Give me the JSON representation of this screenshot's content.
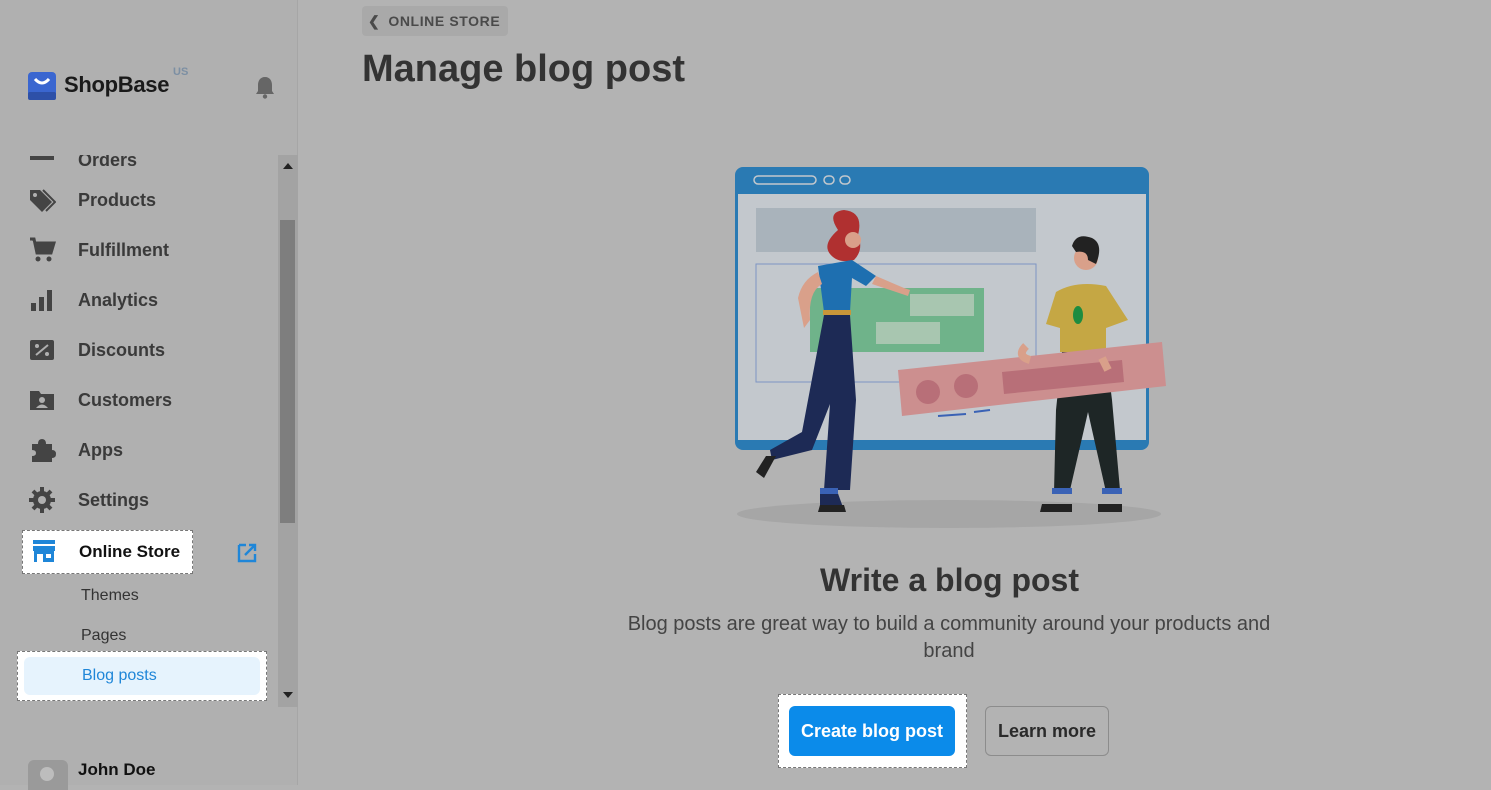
{
  "brand": {
    "name": "ShopBase",
    "region": "US"
  },
  "sidebar": {
    "cut_item": "Orders",
    "items": [
      {
        "label": "Products",
        "icon": "tag-icon"
      },
      {
        "label": "Fulfillment",
        "icon": "cart-icon"
      },
      {
        "label": "Analytics",
        "icon": "bar-chart-icon"
      },
      {
        "label": "Discounts",
        "icon": "discount-icon"
      },
      {
        "label": "Customers",
        "icon": "customer-folder-icon"
      },
      {
        "label": "Apps",
        "icon": "puzzle-icon"
      },
      {
        "label": "Settings",
        "icon": "gear-icon"
      }
    ],
    "online_store": {
      "label": "Online Store",
      "icon": "store-icon"
    },
    "sub_items": [
      {
        "label": "Themes"
      },
      {
        "label": "Pages"
      },
      {
        "label": "Blog posts",
        "active": true
      }
    ],
    "user": {
      "name": "John Doe"
    }
  },
  "breadcrumb": {
    "label": "ONLINE STORE"
  },
  "page": {
    "title": "Manage blog post"
  },
  "empty_state": {
    "title": "Write a blog post",
    "description": "Blog posts are great way to build a community around your products and brand",
    "primary_button": "Create blog post",
    "secondary_button": "Learn more"
  },
  "colors": {
    "primary": "#0b8bea",
    "active_link": "#1f86d8",
    "overlay": "#b3b3b3"
  }
}
